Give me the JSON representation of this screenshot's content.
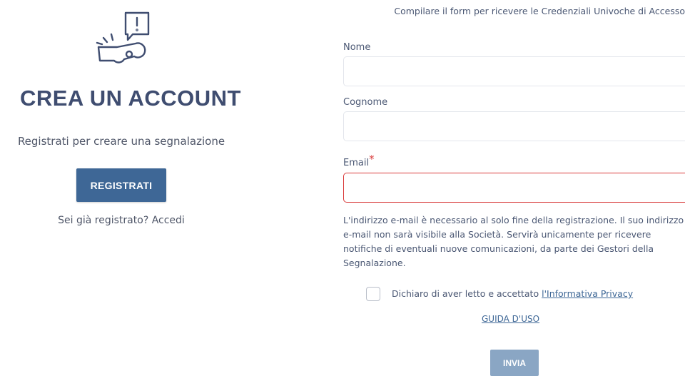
{
  "left": {
    "logo_icon": "whistle-speech-bubble-icon",
    "title": "CREA UN ACCOUNT",
    "subtitle": "Registrati per creare una segnalazione",
    "register_button": "REGISTRATI",
    "already_registered": "Sei già registrato?",
    "login_link": "Accedi"
  },
  "form": {
    "intro": "Compilare il form per ricevere le Credenziali Univoche di Accesso",
    "nome_label": "Nome",
    "nome_value": "",
    "cognome_label": "Cognome",
    "cognome_value": "",
    "email_label": "Email",
    "email_required_mark": "*",
    "email_value": "",
    "email_help": "L'indirizzo e-mail è necessario al solo fine della registrazione. Il suo indirizzo e-mail non sarà visibile alla Società. Servirà unicamente per ricevere notifiche di eventuali nuove comunicazioni, da parte dei Gestori della Segnalazione.",
    "privacy_text": "Dichiaro di aver letto e accettato",
    "privacy_link": "l'Informativa Privacy",
    "privacy_checked": false,
    "guide_link": "GUIDA D'USO",
    "submit_button": "INVIA"
  },
  "colors": {
    "primary": "#3e6796",
    "submit_disabled": "#8aa6c4",
    "error": "#d93b3b",
    "title": "#3f4d70"
  }
}
